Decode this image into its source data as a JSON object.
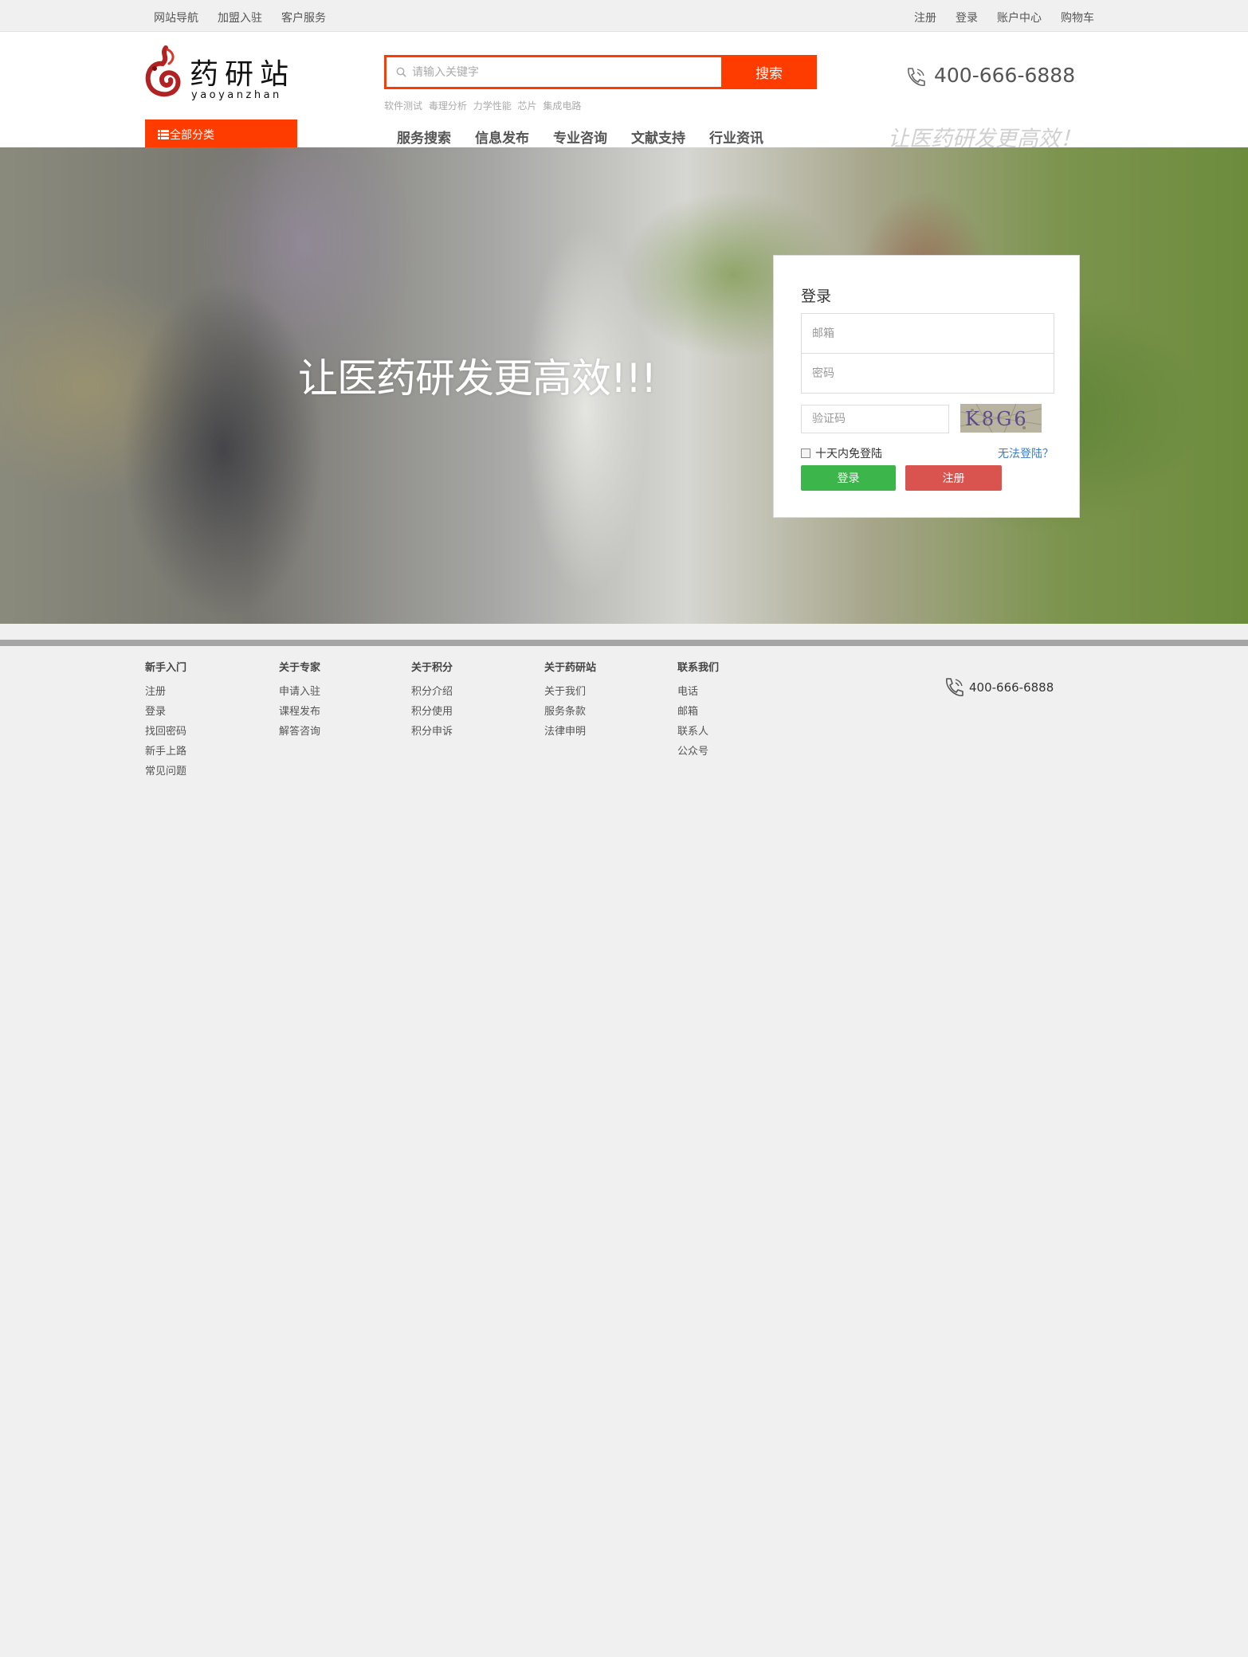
{
  "topbar": {
    "left": [
      "网站导航",
      "加盟入驻",
      "客户服务"
    ],
    "right": [
      "注册",
      "登录",
      "账户中心",
      "购物车"
    ]
  },
  "logo": {
    "name": "药研站",
    "pinyin": "yaoyanzhan"
  },
  "search": {
    "placeholder": "请输入关键字",
    "button": "搜索",
    "hot_keywords": [
      "软件测试",
      "毒理分析",
      "力学性能",
      "芯片",
      "集成电路"
    ]
  },
  "phone": "400-666-6888",
  "category_button": "全部分类",
  "nav": [
    "服务搜索",
    "信息发布",
    "专业咨询",
    "文献支持",
    "行业资讯"
  ],
  "slogan": "让医药研发更高效！",
  "hero": {
    "title": "让医药研发更高效!!!"
  },
  "login": {
    "title": "登录",
    "email_placeholder": "邮箱",
    "password_placeholder": "密码",
    "captcha_placeholder": "验证码",
    "captcha_text": "K8G6",
    "remember": "十天内免登陆",
    "forgot": "无法登陆？",
    "login_button": "登录",
    "register_button": "注册"
  },
  "footer": {
    "columns": [
      {
        "title": "新手入门",
        "links": [
          "注册",
          "登录",
          "找回密码",
          "新手上路",
          "常见问题"
        ]
      },
      {
        "title": "关于专家",
        "links": [
          "申请入驻",
          "课程发布",
          "解答咨询"
        ]
      },
      {
        "title": "关于积分",
        "links": [
          "积分介绍",
          "积分使用",
          "积分申诉"
        ]
      },
      {
        "title": "关于药研站",
        "links": [
          "关于我们",
          "服务条款",
          "法律申明"
        ]
      },
      {
        "title": "联系我们",
        "links": [
          "电话",
          "邮箱",
          "联系人",
          "公众号"
        ]
      }
    ],
    "phone": "400-666-6888"
  },
  "colors": {
    "accent": "#ff3c00",
    "login_button": "#3cb64b",
    "register_button": "#d9534f",
    "link": "#3a7bd5"
  }
}
